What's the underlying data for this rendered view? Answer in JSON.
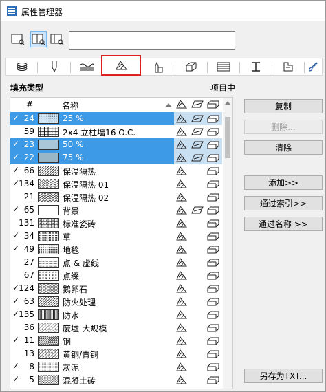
{
  "window": {
    "title": "属性管理器"
  },
  "search": {
    "placeholder": "",
    "value": ""
  },
  "tabs": [
    "fill-icon-selected",
    "layers-icon",
    "pen-icon",
    "lines-icon",
    "zone-icon",
    "building-material-icon",
    "composite-icon",
    "profile-icon",
    "surface-icon",
    "brush-icon"
  ],
  "list": {
    "section_title": "填充类型",
    "in_project_label": "项目中",
    "columns": {
      "num": "#",
      "name": "名称"
    },
    "rows": [
      {
        "check": "✓",
        "num": "24",
        "name": "25 %",
        "selected": true,
        "pattern": "dots-light",
        "c1": true,
        "c2": true,
        "c3": true
      },
      {
        "check": "",
        "num": "59",
        "name": "2x4 立柱墙16 O.C.",
        "selected": false,
        "pattern": "studs",
        "c1": true,
        "c2": true,
        "c3": true
      },
      {
        "check": "✓",
        "num": "23",
        "name": "50 %",
        "selected": true,
        "pattern": "solid-50",
        "c1": true,
        "c2": true,
        "c3": true
      },
      {
        "check": "✓",
        "num": "22",
        "name": "75 %",
        "selected": true,
        "pattern": "solid-75",
        "c1": true,
        "c2": true,
        "c3": true
      },
      {
        "check": "✓",
        "num": "66",
        "name": "保温隔热",
        "selected": false,
        "pattern": "diag",
        "c1": true,
        "c2": false,
        "c3": true
      },
      {
        "check": "✓",
        "num": "134",
        "name": "保温隔热 01",
        "selected": false,
        "pattern": "wave",
        "c1": true,
        "c2": false,
        "c3": true
      },
      {
        "check": "",
        "num": "21",
        "name": "保温隔热 02",
        "selected": false,
        "pattern": "wave2",
        "c1": true,
        "c2": false,
        "c3": true
      },
      {
        "check": "✓",
        "num": "65",
        "name": "背景",
        "selected": false,
        "pattern": "blank",
        "c1": true,
        "c2": true,
        "c3": true
      },
      {
        "check": "",
        "num": "131",
        "name": "标准瓷砖",
        "selected": false,
        "pattern": "grid",
        "c1": true,
        "c2": false,
        "c3": true
      },
      {
        "check": "✓",
        "num": "34",
        "name": "草",
        "selected": false,
        "pattern": "grass",
        "c1": true,
        "c2": false,
        "c3": true
      },
      {
        "check": "✓",
        "num": "49",
        "name": "地毯",
        "selected": false,
        "pattern": "dots-heavy",
        "c1": true,
        "c2": false,
        "c3": true
      },
      {
        "check": "",
        "num": "27",
        "name": "点 & 虚线",
        "selected": false,
        "pattern": "dashes",
        "c1": true,
        "c2": false,
        "c3": true
      },
      {
        "check": "",
        "num": "67",
        "name": "点缀",
        "selected": false,
        "pattern": "cross",
        "c1": true,
        "c2": false,
        "c3": true
      },
      {
        "check": "✓",
        "num": "124",
        "name": "鹅卵石",
        "selected": false,
        "pattern": "pebble",
        "c1": true,
        "c2": false,
        "c3": true
      },
      {
        "check": "✓",
        "num": "63",
        "name": "防火处理",
        "selected": false,
        "pattern": "diag",
        "c1": true,
        "c2": false,
        "c3": true
      },
      {
        "check": "✓",
        "num": "135",
        "name": "防水",
        "selected": false,
        "pattern": "vlines",
        "c1": true,
        "c2": false,
        "c3": true
      },
      {
        "check": "",
        "num": "36",
        "name": "废墟-大规模",
        "selected": false,
        "pattern": "hatch",
        "c1": true,
        "c2": false,
        "c3": true
      },
      {
        "check": "✓",
        "num": "11",
        "name": "钢",
        "selected": false,
        "pattern": "diag-dense",
        "c1": true,
        "c2": false,
        "c3": true
      },
      {
        "check": "",
        "num": "13",
        "name": "黄铜/青铜",
        "selected": false,
        "pattern": "diag2",
        "c1": true,
        "c2": false,
        "c3": true
      },
      {
        "check": "✓",
        "num": "8",
        "name": "灰泥",
        "selected": false,
        "pattern": "dots-fine",
        "c1": true,
        "c2": false,
        "c3": true
      },
      {
        "check": "✓",
        "num": "5",
        "name": "混凝土砖",
        "selected": false,
        "pattern": "crosshatch",
        "c1": true,
        "c2": false,
        "c3": true
      }
    ]
  },
  "buttons": {
    "duplicate": "复制",
    "delete": "删除...",
    "clear": "清除",
    "add": "添加>>",
    "by_index": "通过索引>>",
    "by_name": "通过名称 >>",
    "save_txt": "另存为TXT..."
  }
}
